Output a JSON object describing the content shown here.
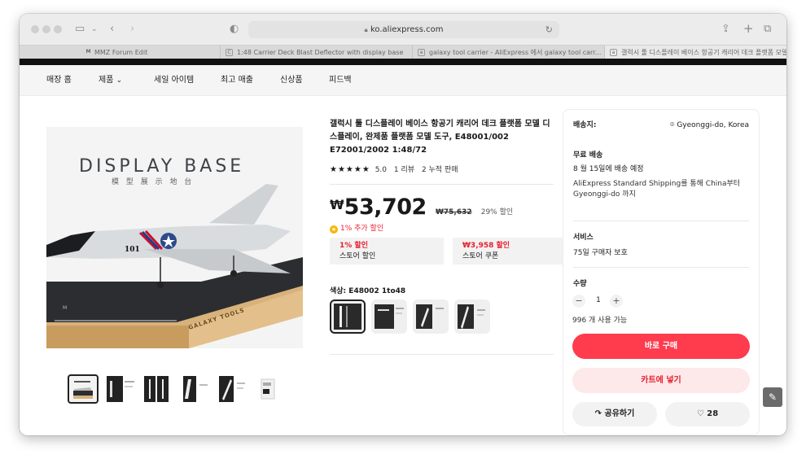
{
  "browser": {
    "url": "ko.aliexpress.com",
    "tabs": [
      {
        "icon": "M",
        "label": "MMZ Forum Edit"
      },
      {
        "icon": "C",
        "label": "1:48 Carrier Deck Blast Deflector with display base"
      },
      {
        "icon": "a",
        "label": "galaxy tool carrier - AliExpress 에서 galaxy tool carr..."
      },
      {
        "icon": "a",
        "label": "갤럭시 툴 디스플레이 베이스 항공기 캐리어 데크 플랫폼 모델..."
      }
    ]
  },
  "nav": {
    "items": [
      "매장 홈",
      "제품",
      "세일 아이템",
      "최고 매출",
      "신상품",
      "피드백"
    ]
  },
  "gallery": {
    "hero_heading": "DISPLAY BASE",
    "hero_sub": "模 型 展 示 地 台",
    "base_brand": "GALAXY TOOLS",
    "jet_number": "101"
  },
  "product": {
    "title": "갤럭시 툴 디스플레이 베이스 항공기 캐리어 데크 플랫폼 모델 디스플레이, 완제품 플랫폼 모델 도구, E48001/002 E72001/2002 1:48/72",
    "rating": "5.0",
    "reviews": "1 리뷰",
    "sold": "2 누적 판매",
    "currency": "₩",
    "price": "53,702",
    "original_price": "₩75,632",
    "discount": "29% 할인",
    "extra_discount": "1% 추가 할인",
    "coupons": [
      {
        "value": "1% 할인",
        "label": "스토어 할인"
      },
      {
        "value": "₩3,958 할인",
        "label": "스토어 쿠폰"
      }
    ],
    "color_label": "색상: E48002 1to48"
  },
  "panel": {
    "ship_to_label": "배송지:",
    "ship_to_value": "Gyeonggi-do, Korea",
    "shipping_title": "무료 배송",
    "delivery_date": "8 월 15일에 배송 예정",
    "shipping_desc": "AliExpress Standard Shipping를 통해 China부터Gyeonggi-do 까지",
    "service_title": "서비스",
    "service_desc": "75일 구매자 보호",
    "qty_title": "수량",
    "qty_value": "1",
    "stock": "996 개 사용 가능",
    "buy_now": "바로 구매",
    "add_to_cart": "카트에 넣기",
    "share": "공유하기",
    "wishlist_count": "28"
  },
  "colors": {
    "accent": "#ff3b4e",
    "accent_light": "#fde8ea",
    "discount_red": "#e8202e"
  }
}
